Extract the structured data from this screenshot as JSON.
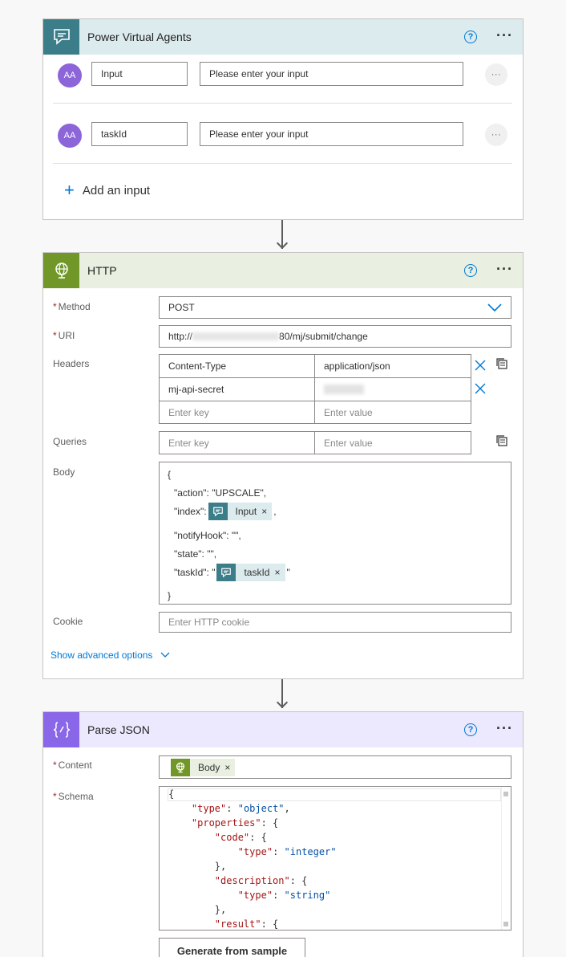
{
  "pva": {
    "title": "Power Virtual Agents",
    "help": "?",
    "more": "···",
    "inputs": [
      {
        "avatar": "AA",
        "name": "Input",
        "placeholder": "Please enter your input",
        "more": "···"
      },
      {
        "avatar": "AA",
        "name": "taskId",
        "placeholder": "Please enter your input",
        "more": "···"
      }
    ],
    "add_input": "Add an input",
    "add_icon": "+"
  },
  "http": {
    "title": "HTTP",
    "help": "?",
    "more": "···",
    "method_label": "Method",
    "method_value": "POST",
    "uri_label": "URI",
    "uri_prefix": "http://",
    "uri_suffix": "80/mj/submit/change",
    "headers_label": "Headers",
    "headers": [
      {
        "key": "Content-Type",
        "value": "application/json"
      },
      {
        "key": "mj-api-secret",
        "value": ""
      }
    ],
    "enter_key": "Enter key",
    "enter_value": "Enter value",
    "queries_label": "Queries",
    "body_label": "Body",
    "body": {
      "open": "{",
      "action": "\"action\": \"UPSCALE\",",
      "index_prefix": "\"index\":",
      "index_token": "Input",
      "index_suffix": ",",
      "notify": "\"notifyHook\": \"\",",
      "state": "\"state\": \"\",",
      "task_prefix": "\"taskId\": \"",
      "task_token": "taskId",
      "task_suffix": "\"",
      "close": "}"
    },
    "cookie_label": "Cookie",
    "cookie_placeholder": "Enter HTTP cookie",
    "advanced": "Show advanced options",
    "token_remove": "×"
  },
  "parse": {
    "title": "Parse JSON",
    "help": "?",
    "more": "···",
    "content_label": "Content",
    "content_token": "Body",
    "schema_label": "Schema",
    "schema_lines": [
      {
        "indent": "",
        "k": "",
        "rest": "{"
      },
      {
        "indent": "    ",
        "k": "\"type\"",
        "rest": ": ",
        "s": "\"object\"",
        "tail": ","
      },
      {
        "indent": "    ",
        "k": "\"properties\"",
        "rest": ": {"
      },
      {
        "indent": "        ",
        "k": "\"code\"",
        "rest": ": {"
      },
      {
        "indent": "            ",
        "k": "\"type\"",
        "rest": ": ",
        "s": "\"integer\""
      },
      {
        "indent": "        ",
        "k": "",
        "rest": "},"
      },
      {
        "indent": "        ",
        "k": "\"description\"",
        "rest": ": {"
      },
      {
        "indent": "            ",
        "k": "\"type\"",
        "rest": ": ",
        "s": "\"string\""
      },
      {
        "indent": "        ",
        "k": "",
        "rest": "},"
      },
      {
        "indent": "        ",
        "k": "\"result\"",
        "rest": ": {"
      }
    ],
    "generate_button": "Generate from sample"
  },
  "colors": {
    "pva_accent": "#3b7d89",
    "http_accent": "#709727",
    "parse_accent": "#8a67e8",
    "link": "#0078d4"
  }
}
